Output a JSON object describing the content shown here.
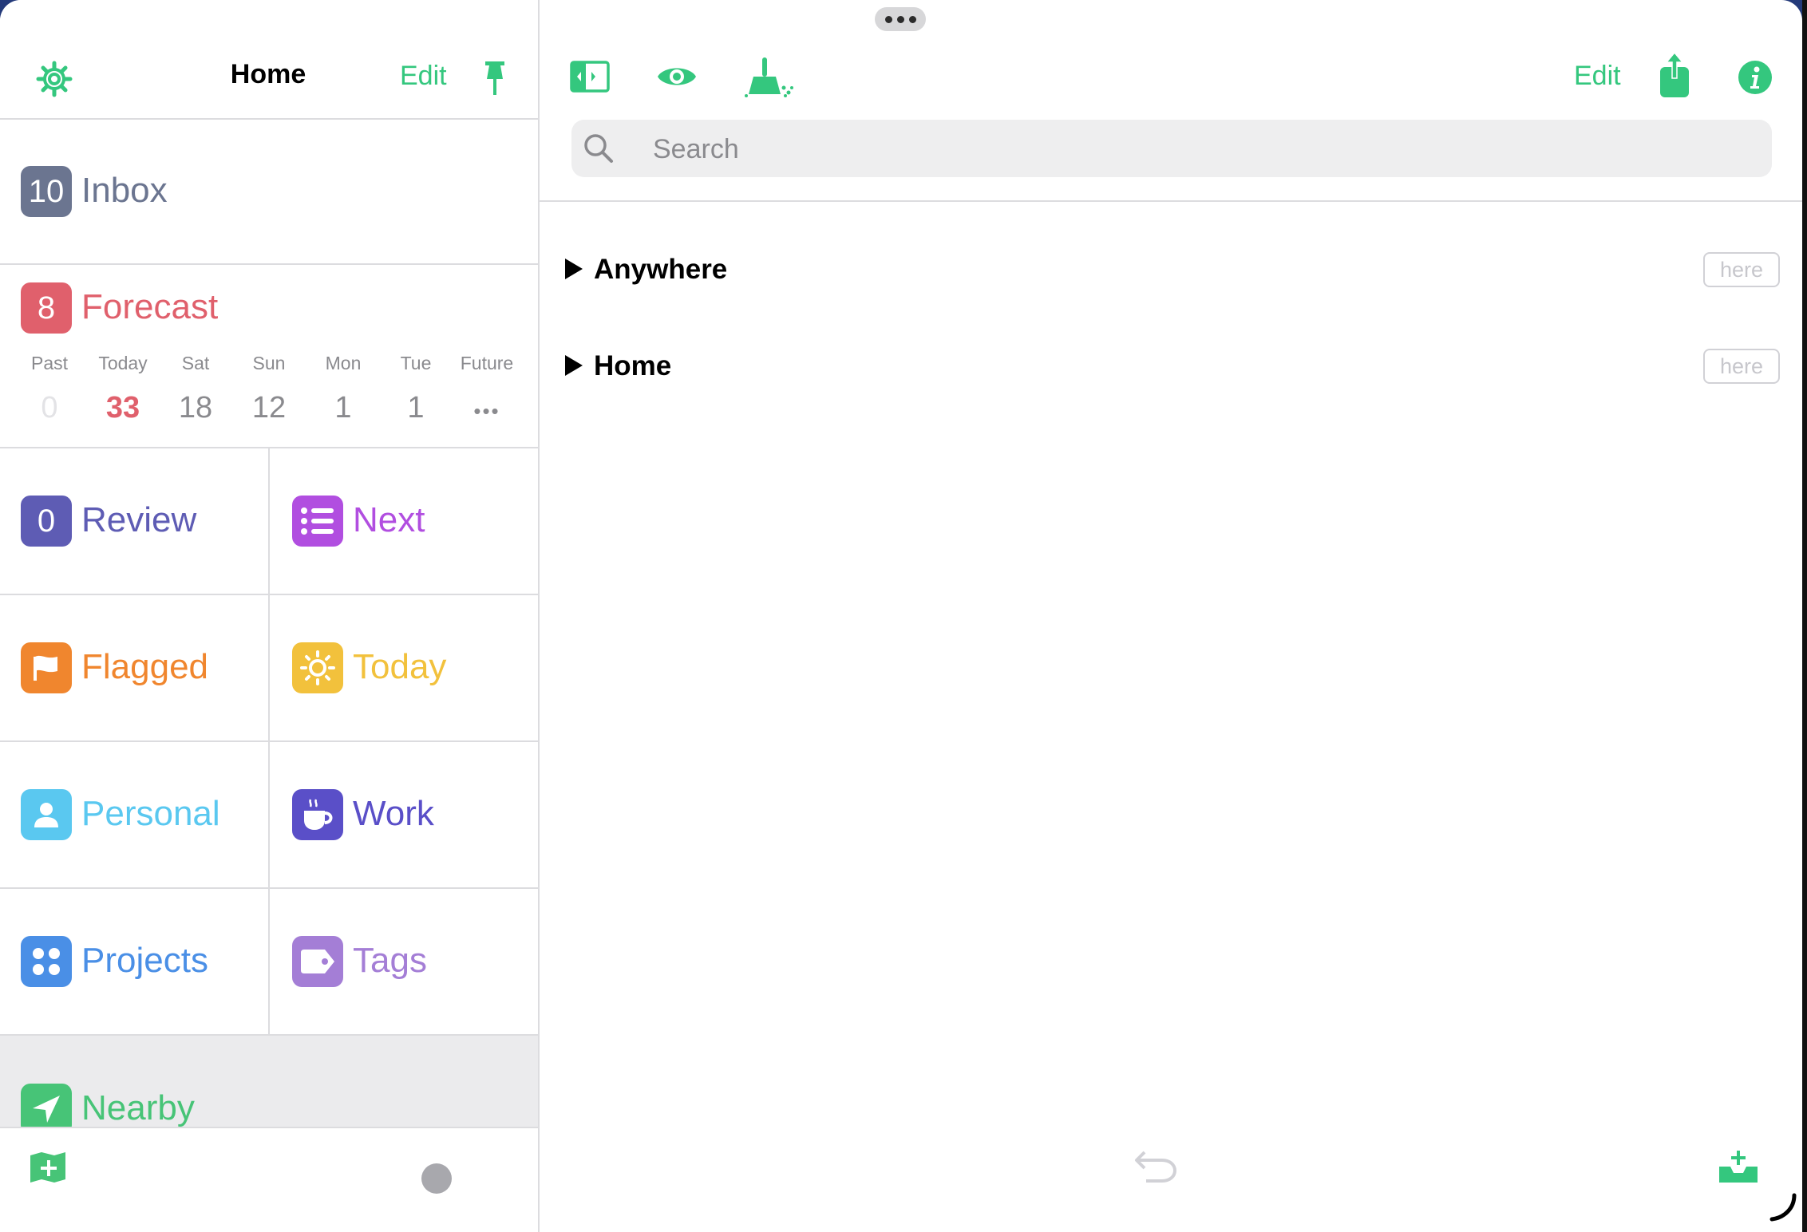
{
  "sidebar": {
    "title": "Home",
    "edit_label": "Edit",
    "inbox": {
      "count": "10",
      "label": "Inbox"
    },
    "forecast": {
      "count": "8",
      "label": "Forecast",
      "days": [
        {
          "day": "Past",
          "count": "0"
        },
        {
          "day": "Today",
          "count": "33"
        },
        {
          "day": "Sat",
          "count": "18"
        },
        {
          "day": "Sun",
          "count": "12"
        },
        {
          "day": "Mon",
          "count": "1"
        },
        {
          "day": "Tue",
          "count": "1"
        },
        {
          "day": "Future",
          "count": "•••"
        }
      ]
    },
    "review": {
      "count": "0",
      "label": "Review"
    },
    "tiles": {
      "next": "Next",
      "flagged": "Flagged",
      "today": "Today",
      "personal": "Personal",
      "work": "Work",
      "projects": "Projects",
      "tags": "Tags",
      "nearby": "Nearby"
    }
  },
  "main": {
    "edit_label": "Edit",
    "search_placeholder": "Search",
    "locations": [
      {
        "label": "Anywhere",
        "button": "here"
      },
      {
        "label": "Home",
        "button": "here"
      }
    ]
  },
  "colors": {
    "accent": "#34c77e",
    "inbox": "#6b7590",
    "forecast": "#e0606c",
    "review": "#5e5cb4",
    "next": "#b14ee0",
    "flagged": "#f0862e",
    "today": "#f2c13c",
    "personal": "#5ac8f0",
    "work": "#5a4fc8",
    "projects": "#4a8fe6",
    "tags": "#a47ed6",
    "nearby": "#47c477"
  },
  "icons": [
    "gear-icon",
    "pin-icon",
    "sidebar-toggle-icon",
    "eye-icon",
    "broom-icon",
    "share-icon",
    "info-icon",
    "search-icon",
    "undo-icon",
    "inbox-add-icon",
    "new-perspective-icon",
    "sun-icon",
    "flag-icon",
    "list-icon",
    "person-icon",
    "cup-icon",
    "dots-icon",
    "tag-icon",
    "location-arrow-icon"
  ]
}
